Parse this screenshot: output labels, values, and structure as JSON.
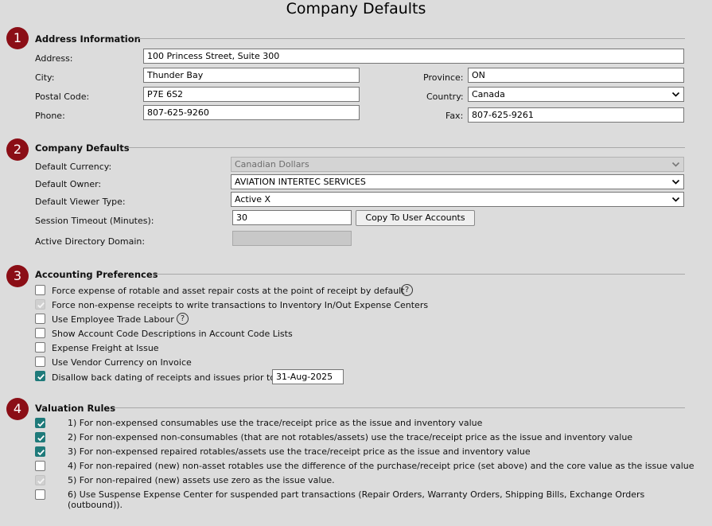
{
  "title": "Company Defaults",
  "sections": {
    "address": {
      "number": "1",
      "heading": "Address Information",
      "address_label": "Address:",
      "address_value": "100 Princess Street, Suite 300",
      "city_label": "City:",
      "city_value": "Thunder Bay",
      "province_label": "Province:",
      "province_value": "ON",
      "postal_label": "Postal Code:",
      "postal_value": "P7E 6S2",
      "country_label": "Country:",
      "country_value": "Canada",
      "phone_label": "Phone:",
      "phone_value": "807-625-9260",
      "fax_label": "Fax:",
      "fax_value": "807-625-9261"
    },
    "company": {
      "number": "2",
      "heading": "Company Defaults",
      "currency_label": "Default Currency:",
      "currency_value": "Canadian Dollars",
      "owner_label": "Default Owner:",
      "owner_value": "AVIATION INTERTEC SERVICES",
      "viewer_label": "Default Viewer Type:",
      "viewer_value": "Active X",
      "timeout_label": "Session Timeout (Minutes):",
      "timeout_value": "30",
      "copy_button": "Copy To User Accounts",
      "ad_label": "Active Directory Domain:",
      "ad_value": ""
    },
    "accounting": {
      "number": "3",
      "heading": "Accounting Preferences",
      "items": [
        {
          "label": "Force expense of rotable and asset repair costs at the point of receipt by default",
          "state": "unchecked",
          "help": "?"
        },
        {
          "label": "Force non-expense receipts to write transactions to Inventory In/Out Expense Centers",
          "state": "disabled-checked"
        },
        {
          "label": "Use Employee Trade Labour",
          "state": "unchecked",
          "help": "?"
        },
        {
          "label": "Show Account Code Descriptions in Account Code Lists",
          "state": "unchecked"
        },
        {
          "label": "Expense Freight at Issue",
          "state": "unchecked"
        },
        {
          "label": "Use Vendor Currency on Invoice",
          "state": "unchecked"
        },
        {
          "label": "Disallow back dating of receipts and issues prior to",
          "state": "checked",
          "date": "31-Aug-2025"
        }
      ]
    },
    "valuation": {
      "number": "4",
      "heading": "Valuation Rules",
      "items": [
        {
          "label": "1) For non-expensed consumables use the trace/receipt price as the issue and inventory value",
          "state": "checked"
        },
        {
          "label": "2) For non-expensed non-consumables (that are not rotables/assets) use the trace/receipt price as the issue and inventory value",
          "state": "checked"
        },
        {
          "label": "3) For non-expensed repaired rotables/assets use the trace/receipt price as the issue and inventory value",
          "state": "checked"
        },
        {
          "label": "4) For non-repaired (new) non-asset rotables use the difference of the purchase/receipt price (set above) and the core value as the issue value",
          "state": "unchecked"
        },
        {
          "label": "5) For non-repaired (new) assets use zero as the issue value.",
          "state": "disabled-checked"
        },
        {
          "label_line1": "6) Use Suspense Expense Center for suspended part transactions (Repair Orders, Warranty Orders, Shipping Bills, Exchange Orders",
          "label_line2": "(outbound)).",
          "state": "unchecked"
        }
      ]
    }
  },
  "colors": {
    "badge": "#8b0e16",
    "checkbox_checked": "#1f7a7a",
    "background": "#dcdcdc"
  },
  "icons": {
    "select": "chevron-down-icon",
    "help": "help-circle-icon",
    "check": "checkmark-icon"
  }
}
